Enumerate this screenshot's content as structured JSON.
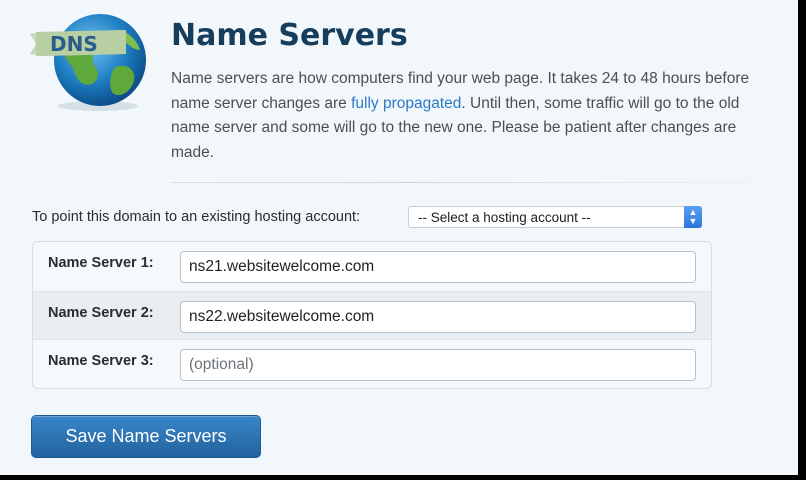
{
  "header": {
    "logo_text": "DNS",
    "title": "Name Servers",
    "description_before_link": "Name servers are how computers find your web page. It takes 24 to 48 hours before name server changes are ",
    "link_text": "fully propagated",
    "description_after_link": ". Until then, some traffic will go to the old name server and some will go to the new one. Please be patient after changes are made."
  },
  "hosting": {
    "label": "To point this domain to an existing hosting account:",
    "select_value": "-- Select a hosting account --"
  },
  "name_servers": [
    {
      "label": "Name Server 1:",
      "value": "ns21.websitewelcome.com",
      "placeholder": ""
    },
    {
      "label": "Name Server 2:",
      "value": "ns22.websitewelcome.com",
      "placeholder": ""
    },
    {
      "label": "Name Server 3:",
      "value": "",
      "placeholder": "(optional)"
    }
  ],
  "actions": {
    "save_label": "Save Name Servers"
  },
  "colors": {
    "title": "#173d5c",
    "link": "#2b78c5",
    "button": "#2a6eab",
    "background": "#f1f7fb"
  }
}
